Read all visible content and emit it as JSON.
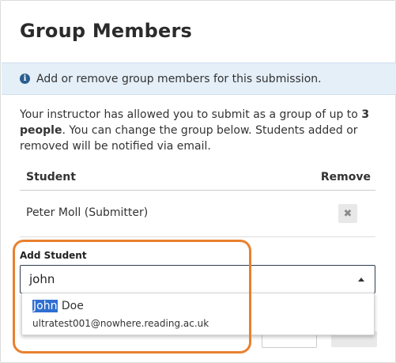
{
  "dialog": {
    "title": "Group Members",
    "info_text": "Add or remove group members for this submission.",
    "description_prefix": "Your instructor has allowed you to submit as a group of up to ",
    "description_bold": "3 people",
    "description_suffix": ". You can change the group below. Students added or removed will be notified via email."
  },
  "table": {
    "col_student": "Student",
    "col_remove": "Remove",
    "rows": [
      {
        "name": "Peter Moll (Submitter)"
      }
    ]
  },
  "add_student": {
    "label": "Add Student",
    "value": "john",
    "suggestion": {
      "name_match": "John",
      "name_rest": " Doe",
      "email": "ultratest001@nowhere.reading.ac.uk"
    }
  },
  "icons": {
    "info": "info-icon",
    "remove": "close-icon",
    "caret": "caret-up-icon"
  },
  "colors": {
    "info_bg": "#e4eff8",
    "info_icon": "#2a5d8f",
    "highlight": "#2f6fd1",
    "callout": "#e9802e"
  }
}
